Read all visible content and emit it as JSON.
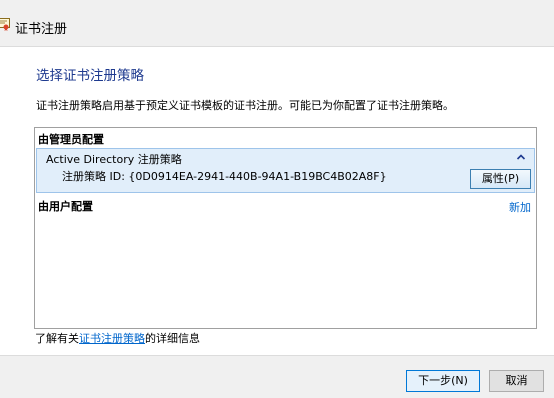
{
  "window": {
    "title": "证书注册",
    "icon": "certificate-icon"
  },
  "page": {
    "heading": "选择证书注册策略",
    "intro": "证书注册策略启用基于预定义证书模板的证书注册。可能已为你配置了证书注册策略。"
  },
  "policy_list": {
    "admin_group_label": "由管理员配置",
    "items": [
      {
        "name": "Active Directory 注册策略",
        "id_text": "注册策略 ID: {0D0914EA-2941-440B-94A1-B19BC4B02A8F}",
        "properties_label": "属性(P)"
      }
    ],
    "user_group_label": "由用户配置",
    "add_label": "新加"
  },
  "info": {
    "prefix": "了解有关",
    "link": "证书注册策略",
    "suffix": "的详细信息"
  },
  "footer": {
    "next_label": "下一步(N)",
    "cancel_label": "取消"
  }
}
